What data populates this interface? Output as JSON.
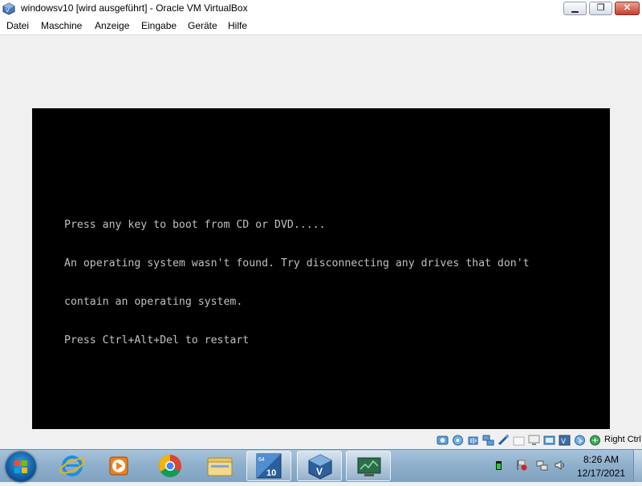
{
  "window": {
    "title": "windowsv10 [wird ausgeführt] - Oracle VM VirtualBox",
    "icon": "virtualbox-icon",
    "controls": [
      "minimize",
      "maximize",
      "close"
    ]
  },
  "menu": [
    {
      "label": "Datei"
    },
    {
      "label": "Maschine"
    },
    {
      "label": "Anzeige"
    },
    {
      "label": "Eingabe"
    },
    {
      "label": "Geräte"
    },
    {
      "label": "Hilfe"
    }
  ],
  "console": {
    "lines": [
      "Press any key to boot from CD or DVD.....",
      "An operating system wasn't found. Try disconnecting any drives that don't",
      "contain an operating system.",
      "Press Ctrl+Alt+Del to restart"
    ],
    "background": "#000000",
    "foreground": "#c0c0c0"
  },
  "statusbar": {
    "icons": [
      "hard-disk-icon",
      "optical-drive-icon",
      "audio-icon",
      "network-icon",
      "usb-icon",
      "shared-folder-icon",
      "display-icon",
      "video-capture-icon",
      "virtualization-icon",
      "mouse-integration-icon",
      "keyboard-icon"
    ],
    "host_key": "Right Ctrl"
  },
  "taskbar": {
    "apps": [
      {
        "name": "internet-explorer",
        "icon": "internet-explorer-icon",
        "open": false
      },
      {
        "name": "media-player",
        "icon": "media-player-icon",
        "open": false
      },
      {
        "name": "chrome",
        "icon": "chrome-icon",
        "open": false
      },
      {
        "name": "file-explorer",
        "icon": "folder-icon",
        "open": false
      },
      {
        "name": "windows10-vm",
        "icon": "windows10-64-icon",
        "open": true
      },
      {
        "name": "virtualbox-manager",
        "icon": "virtualbox-icon",
        "open": true
      },
      {
        "name": "vm-window",
        "icon": "vm-monitor-icon",
        "open": true
      }
    ],
    "tray_icons": [
      "battery-icon",
      "flag-icon",
      "network-icon",
      "volume-icon"
    ],
    "clock": {
      "time": "8:26 AM",
      "date": "12/17/2021"
    }
  },
  "colors": {
    "vm_background": "#f0f0f0",
    "taskbar": "#8fb0cc",
    "close_button": "#c7402c"
  }
}
